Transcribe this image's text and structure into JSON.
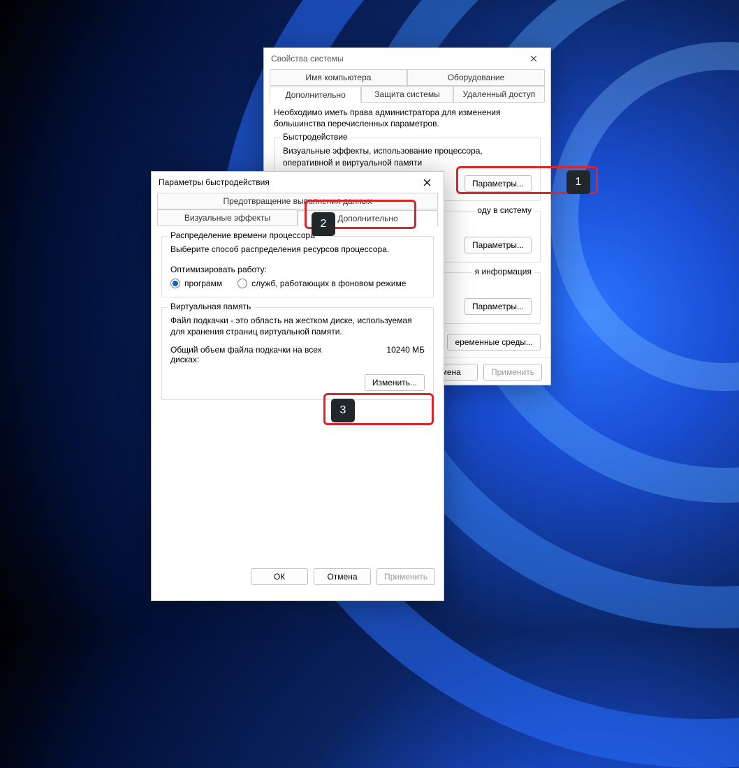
{
  "sys": {
    "title": "Свойства системы",
    "tabs_row1": {
      "computer_name": "Имя компьютера",
      "hardware": "Оборудование"
    },
    "tabs_row2": {
      "advanced": "Дополнительно",
      "system_protection": "Защита системы",
      "remote": "Удаленный доступ"
    },
    "admin_note": "Необходимо иметь права администратора для изменения большинства перечисленных параметров.",
    "perf": {
      "title": "Быстродействие",
      "desc": "Визуальные эффекты, использование процессора, оперативной и виртуальной памяти",
      "btn": "Параметры..."
    },
    "profiles": {
      "title_partial": "оду в систему",
      "btn": "Параметры..."
    },
    "startup": {
      "title_partial": "я информация",
      "btn": "Параметры..."
    },
    "envvars_btn": "еременные среды...",
    "footer": {
      "cancel": "тмена",
      "apply": "Применить"
    }
  },
  "perf": {
    "title": "Параметры быстродействия",
    "tabs_row1": {
      "dep": "Предотвращение выполнения данных"
    },
    "tabs_row2": {
      "visual": "Визуальные эффекты",
      "advanced": "Дополнительно"
    },
    "cpu": {
      "title": "Распределение времени процессора",
      "desc": "Выберите способ распределения ресурсов процессора.",
      "optimize_label": "Оптимизировать работу:",
      "opt_programs": "программ",
      "opt_services": "служб, работающих в фоновом режиме"
    },
    "vmem": {
      "title": "Виртуальная память",
      "desc": "Файл подкачки - это область на жестком диске, используемая для хранения страниц виртуальной памяти.",
      "total_label": "Общий объем файла подкачки на всех дисках:",
      "total_value": "10240 МБ",
      "btn": "Изменить..."
    },
    "footer": {
      "ok": "ОК",
      "cancel": "Отмена",
      "apply": "Применить"
    }
  },
  "annotations": {
    "n1": "1",
    "n2": "2",
    "n3": "3"
  }
}
